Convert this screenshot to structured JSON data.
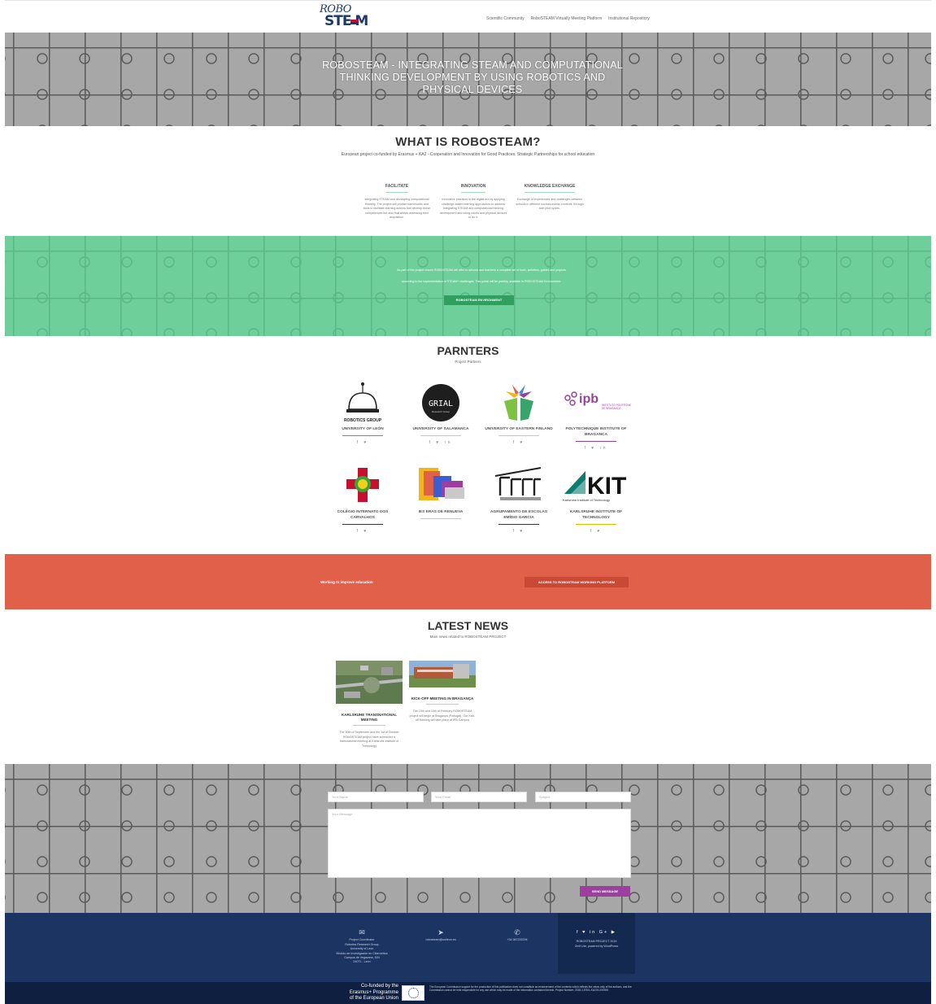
{
  "logo": {
    "top": "ROBO",
    "bottom": "STE M"
  },
  "nav": [
    "Scientific Community",
    "RoboSTEAM Virtually Meeting Platform",
    "Institutional Repository"
  ],
  "hero": {
    "title": "ROBOSTEAM - INTEGRATING STEAM AND COMPUTATIONAL THINKING DEVELOPMENT BY USING ROBOTICS AND PHYSICAL DEVICES"
  },
  "what": {
    "title": "WHAT IS ROBOSTEAM?",
    "subtitle": "European project co-funded by Erasmus + KA2 - Cooperation and Innovation for Good Practices. Strategic Partnerships for school education",
    "columns": [
      {
        "title": "FACILITATE",
        "text": "Integrating STEAM and developing computational thinking. The project will provide frameworks and tools to facilitate learning actions that develop these competences but also that allows assessing their acquisition."
      },
      {
        "title": "INNOVATION",
        "text": "Innovative practices in the digital era by applying challenge-based learning approaches to address integrating STEAM and computational thinking development and using robots and physical devices to do it."
      },
      {
        "title": "KNOWLEDGE EXCHANGE",
        "text": "Exchange of experiences and challenges between schools in different socioeconomic contexts, through twin pilot cycles."
      }
    ]
  },
  "green": {
    "line1": "As part of the project results ROBOSTEAM will offer to schools and teachers a complete set of tools, activities, guides and projects",
    "line2": "according to the implementation of STEAM+ challenges. This portal will be publicly available in ROBOSTEAM Environment.",
    "button": "ROBOSTEAM ENVIRONMENT"
  },
  "partners": {
    "title": "PARNTERS",
    "subtitle": "Project Partners",
    "items": [
      {
        "name": "UNIVERSITY OF LEÓN",
        "social": "f ♥",
        "logo": "robotics-group-logo",
        "color": "#e0604a"
      },
      {
        "name": "UNIVERSITY OF SALAMANCA",
        "social": "f ♥ in",
        "logo": "grial-logo",
        "color": "#9be0bb"
      },
      {
        "name": "UNIVERSITY OF EASTERN FINLAND",
        "social": "f ♥",
        "logo": "uef-logo",
        "color": "#9be0bb"
      },
      {
        "name": "POLYTECHNIQUE INSTITUTE OF BRAGANCA",
        "social": "f ♥ in",
        "logo": "ipb-logo",
        "color": "#9c3f9e"
      },
      {
        "name": "COLÉGIO INTERNATO DOS CARVALHOS",
        "social": "f ♥",
        "logo": "cic-logo",
        "color": "#333333"
      },
      {
        "name": "IES ERAS DE RENUEVA",
        "social": "",
        "logo": "ies-logo",
        "color": "#9be0bb"
      },
      {
        "name": "AGRUPAMENTO DE ESCOLAS EMÍDIO GARCIA",
        "social": "f ♥",
        "logo": "aeeg-logo",
        "color": "#333333"
      },
      {
        "name": "KARLSRUHE INSTITUTE OF TECHNOLOGY",
        "social": "f ♥",
        "logo": "kit-logo",
        "color": "#e6b800"
      }
    ]
  },
  "red": {
    "text": "Working to improve education",
    "button": "ACCESS TO ROBOSTEAM WORKING PLATFORM"
  },
  "news": {
    "title": "LATEST NEWS",
    "subtitle": "Main news related to ROBOSTEAM PROJECT",
    "posts": [
      {
        "title": "KARLSRUHE TRANSNATIONAL MEETING",
        "text": "The 30th of September and the 1st of October ROBOSTEAM project have scheduled a transnational meeting at Karlsruhe Institute of Technology"
      },
      {
        "title": "KICK-OFF MEETING IN BRAGANÇA",
        "text": "The 15th and 16th of February ROBOSTEAM project will begin at Bragança (Portugal). Our Kick-off Meeting will take place at IPB Campus"
      }
    ]
  },
  "contact": {
    "name_placeholder": "Your Name",
    "email_placeholder": "Your Email",
    "subject_placeholder": "Subject",
    "message_placeholder": "Your Message",
    "send": "SEND MESSAGE"
  },
  "footer": {
    "address": [
      "Project Coordinator",
      "Robotics Research Group",
      "University of León",
      "Módulo de Investigación en Cibernética",
      "Campus de Vegazana, S/N",
      "24071 - León"
    ],
    "email": "robosteam@unileon.es",
    "phone": "+34 987293294",
    "social": "f ♥ in G+ ▶",
    "copyright": "ROBOSTEAM PROJECT 2019",
    "theme": "Zerif Lite, powered by WordPress"
  },
  "bottom": {
    "eu": "Co-funded by the Erasmus+ Programme of the European Union",
    "disclaimer": "The European Commission support for the production of this publication does not constitute an endorsement of the contents which reflects the views only of the authors, and the Commission cannot be held responsible for any use which may be made of the information contained therein. Project Number: 2018-1-ES01-KA201-050939"
  },
  "colors": {
    "green": "#6fcf9b",
    "red": "#e0604a",
    "navy": "#1b3462",
    "purple": "#9c3f9e"
  }
}
